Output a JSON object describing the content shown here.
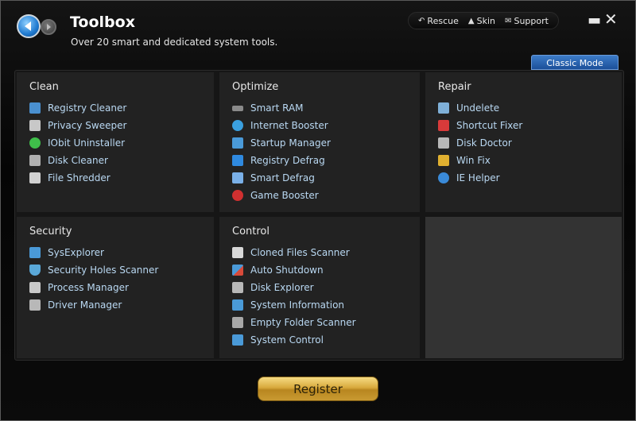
{
  "header": {
    "title": "Toolbox",
    "subtitle": "Over 20 smart and dedicated system tools.",
    "links": [
      {
        "label": "Rescue",
        "icon": "back-arrow-icon"
      },
      {
        "label": "Skin",
        "icon": "shirt-icon"
      },
      {
        "label": "Support",
        "icon": "envelope-icon"
      }
    ],
    "classic_mode": "Classic Mode"
  },
  "sections": {
    "clean": {
      "title": "Clean",
      "items": [
        {
          "label": "Registry Cleaner",
          "icon": "registry-cleaner-icon",
          "color": "#4a90d0"
        },
        {
          "label": "Privacy Sweeper",
          "icon": "broom-icon",
          "color": "#c8c8c8"
        },
        {
          "label": "IObit Uninstaller",
          "icon": "uninstaller-icon",
          "color": "#3fbf4a"
        },
        {
          "label": "Disk Cleaner",
          "icon": "disk-cleaner-icon",
          "color": "#b0b0b0"
        },
        {
          "label": "File Shredder",
          "icon": "shredder-icon",
          "color": "#d0d0d0"
        }
      ]
    },
    "optimize": {
      "title": "Optimize",
      "items": [
        {
          "label": "Smart RAM",
          "icon": "ram-icon",
          "color": "#8a8a8a"
        },
        {
          "label": "Internet Booster",
          "icon": "globe-icon",
          "color": "#3aa0e0"
        },
        {
          "label": "Startup Manager",
          "icon": "monitor-icon",
          "color": "#4a9ad8"
        },
        {
          "label": "Registry Defrag",
          "icon": "registry-defrag-icon",
          "color": "#2f8ae0"
        },
        {
          "label": "Smart Defrag",
          "icon": "defrag-icon",
          "color": "#7ab0e8"
        },
        {
          "label": "Game Booster",
          "icon": "gamepad-icon",
          "color": "#d03030"
        }
      ]
    },
    "repair": {
      "title": "Repair",
      "items": [
        {
          "label": "Undelete",
          "icon": "undelete-icon",
          "color": "#7fb0d8"
        },
        {
          "label": "Shortcut Fixer",
          "icon": "shortcut-icon",
          "color": "#d83a3a"
        },
        {
          "label": "Disk Doctor",
          "icon": "disk-doctor-icon",
          "color": "#b8b8b8"
        },
        {
          "label": "Win Fix",
          "icon": "windows-icon",
          "color": "#e0b030"
        },
        {
          "label": "IE Helper",
          "icon": "ie-icon",
          "color": "#3a8ad8"
        }
      ]
    },
    "security": {
      "title": "Security",
      "items": [
        {
          "label": "SysExplorer",
          "icon": "sysexplorer-icon",
          "color": "#4a9ad8"
        },
        {
          "label": "Security Holes Scanner",
          "icon": "shield-icon",
          "color": "#5aa8d8"
        },
        {
          "label": "Process Manager",
          "icon": "process-icon",
          "color": "#c8c8c8"
        },
        {
          "label": "Driver Manager",
          "icon": "driver-icon",
          "color": "#b8b8b8"
        }
      ]
    },
    "control": {
      "title": "Control",
      "items": [
        {
          "label": "Cloned Files Scanner",
          "icon": "cloned-files-icon",
          "color": "#d8d8d8"
        },
        {
          "label": "Auto Shutdown",
          "icon": "shutdown-icon",
          "color": "#d84a3a"
        },
        {
          "label": "Disk Explorer",
          "icon": "disk-explorer-icon",
          "color": "#b8b8b8"
        },
        {
          "label": "System Information",
          "icon": "system-info-icon",
          "color": "#4a9ad8"
        },
        {
          "label": "Empty Folder Scanner",
          "icon": "empty-folder-icon",
          "color": "#a8a8a8"
        },
        {
          "label": "System Control",
          "icon": "system-control-icon",
          "color": "#4a9ad8"
        }
      ]
    }
  },
  "register_label": "Register"
}
